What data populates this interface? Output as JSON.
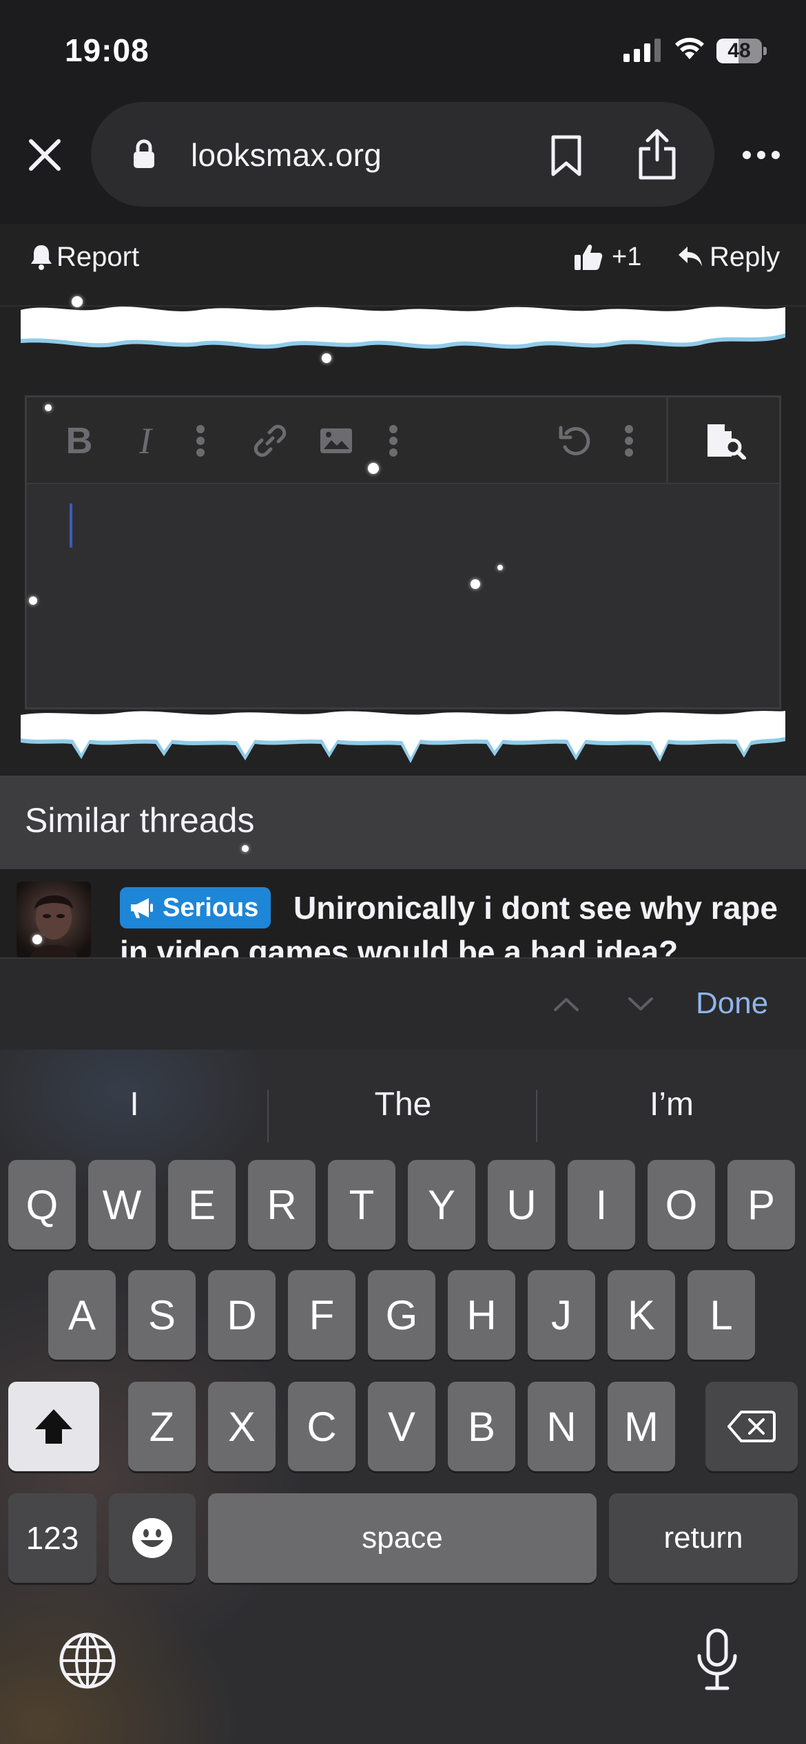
{
  "status_bar": {
    "time": "19:08",
    "battery_level": "48",
    "battery_fraction": 0.48
  },
  "browser": {
    "url": "looksmax.org",
    "icons": [
      "close-icon",
      "lock-icon",
      "bookmark-icon",
      "share-icon",
      "more-icon"
    ]
  },
  "post_actions": {
    "report": "Report",
    "like": "+1",
    "reply": "Reply"
  },
  "editor": {
    "toolbar_icons": [
      "bold-icon",
      "italic-icon",
      "more-vertical-icon",
      "link-icon",
      "image-icon",
      "more-vertical-icon",
      "undo-icon",
      "more-vertical-icon",
      "preview-icon"
    ],
    "bold_glyph": "B",
    "italic_glyph": "I",
    "caret_color": "#3d5ab8"
  },
  "similar_threads": {
    "title": "Similar threads",
    "items": [
      {
        "badge": "Serious",
        "badge_color": "#1e86d7",
        "title": "Unironically i dont see why rape in video games would be a bad idea?"
      }
    ]
  },
  "input_assistant": {
    "done": "Done",
    "accent": "#8fb4ee"
  },
  "keyboard": {
    "predictions": [
      "I",
      "The",
      "I’m"
    ],
    "row1": [
      "Q",
      "W",
      "E",
      "R",
      "T",
      "Y",
      "U",
      "I",
      "O",
      "P"
    ],
    "row2": [
      "A",
      "S",
      "D",
      "F",
      "G",
      "H",
      "J",
      "K",
      "L"
    ],
    "row3": [
      "Z",
      "X",
      "C",
      "V",
      "B",
      "N",
      "M"
    ],
    "numbers_key": "123",
    "space_key": "space",
    "return_key": "return"
  }
}
